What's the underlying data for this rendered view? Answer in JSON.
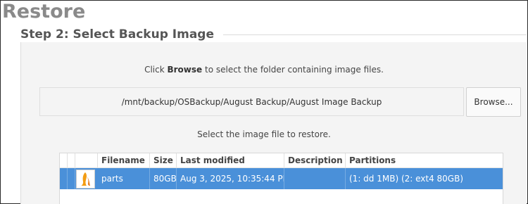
{
  "page": {
    "title": "Restore",
    "step_title": "Step 2: Select Backup Image"
  },
  "folder": {
    "instruction_prefix": "Click ",
    "instruction_bold": "Browse",
    "instruction_suffix": " to select the folder containing image files.",
    "path": "/mnt/backup/OSBackup/August Backup/August Image Backup",
    "browse_label": "Browse..."
  },
  "image": {
    "instruction": "Select the image file to restore."
  },
  "table": {
    "columns": {
      "filename": "Filename",
      "size": "Size",
      "last_modified": "Last modified",
      "description": "Description",
      "partitions": "Partitions"
    },
    "rows": [
      {
        "icon": "disk-image-icon",
        "filename": "parts",
        "size": "80GB",
        "last_modified": "Aug 3, 2025, 10:35:44 PM",
        "description": "",
        "partitions": "(1: dd 1MB) (2: ext4 80GB)",
        "selected": true
      }
    ]
  },
  "colors": {
    "title": "#8a8a8a",
    "selection": "#4a90d9",
    "icon_accent": "#f39c12"
  }
}
